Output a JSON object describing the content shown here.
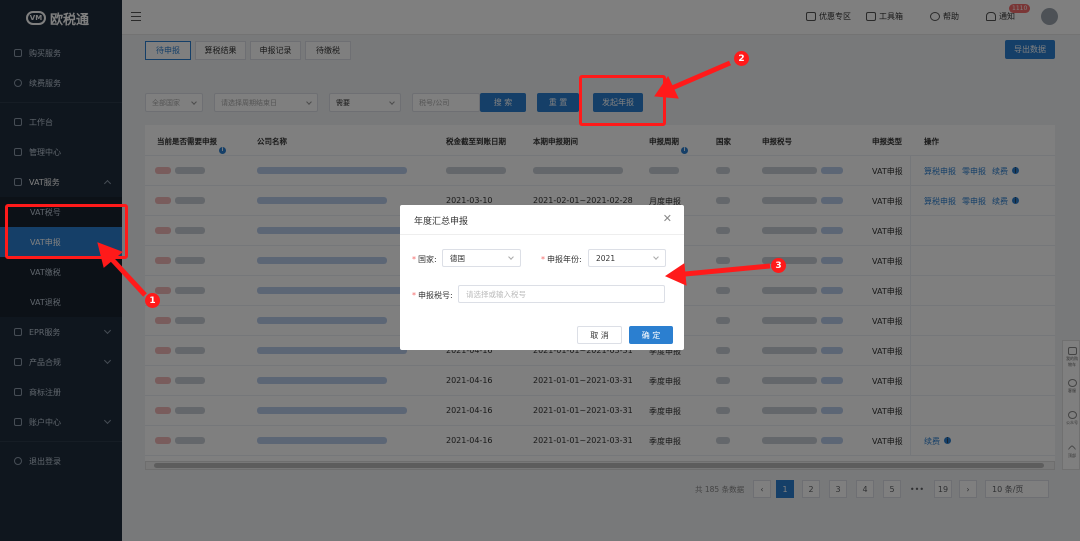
{
  "app": {
    "logo_text": "欧税通",
    "logo_mark": "VM"
  },
  "sidebar": {
    "items": [
      {
        "label": "购买服务",
        "icon": "cart-icon"
      },
      {
        "label": "续费服务",
        "icon": "renew-icon"
      },
      {
        "label": "工作台",
        "icon": "desk-icon"
      },
      {
        "label": "管理中心",
        "icon": "manage-icon"
      },
      {
        "label": "VAT服务",
        "icon": "briefcase-icon"
      },
      {
        "label": "EPR服务",
        "icon": "epr-icon"
      },
      {
        "label": "产品合规",
        "icon": "shield-icon"
      },
      {
        "label": "商标注册",
        "icon": "trademark-icon"
      },
      {
        "label": "账户中心",
        "icon": "account-icon"
      },
      {
        "label": "退出登录",
        "icon": "logout-icon"
      }
    ],
    "vat_sub": [
      "VAT税号",
      "VAT申报",
      "VAT缴税",
      "VAT退税"
    ]
  },
  "topbar": {
    "promo": "优惠专区",
    "toolbox": "工具箱",
    "help": "帮助",
    "notice": "通知",
    "notice_badge": "1110"
  },
  "tabs": [
    "待申报",
    "算税结果",
    "申报记录",
    "待缴税"
  ],
  "export_label": "导出数据",
  "filters": {
    "country_placeholder": "全部国家",
    "date_placeholder": "请选择周期结束日",
    "need_value": "需要",
    "tax_placeholder": "税号/公司",
    "search": "搜 索",
    "reset": "重 置",
    "annual": "发起年报"
  },
  "table": {
    "headers": [
      "当前是否需要申报",
      "公司名称",
      "税金截至到账日期",
      "本期申报期间",
      "申报周期",
      "国家",
      "申报税号",
      "申报类型",
      "操作"
    ],
    "rows": [
      {
        "date": "",
        "period": "",
        "cycle": "",
        "type": "VAT申报",
        "ops": [
          "算税申报",
          "零申报",
          "续费"
        ]
      },
      {
        "date": "2021-03-10",
        "period": "2021-02-01~2021-02-28",
        "cycle": "月度申报",
        "type": "VAT申报",
        "ops": [
          "算税申报",
          "零申报",
          "续费"
        ]
      },
      {
        "date": "",
        "period": "",
        "cycle": "",
        "type": "VAT申报",
        "ops": []
      },
      {
        "date": "",
        "period": "",
        "cycle": "",
        "type": "VAT申报",
        "ops": []
      },
      {
        "date": "",
        "period": "",
        "cycle": "",
        "type": "VAT申报",
        "ops": []
      },
      {
        "date": "",
        "period": "",
        "cycle": "",
        "type": "VAT申报",
        "ops": []
      },
      {
        "date": "2021-04-16",
        "period": "2021-01-01~2021-03-31",
        "cycle": "季度申报",
        "type": "VAT申报",
        "ops": []
      },
      {
        "date": "2021-04-16",
        "period": "2021-01-01~2021-03-31",
        "cycle": "季度申报",
        "type": "VAT申报",
        "ops": []
      },
      {
        "date": "2021-04-16",
        "period": "2021-01-01~2021-03-31",
        "cycle": "季度申报",
        "type": "VAT申报",
        "ops": []
      },
      {
        "date": "2021-04-16",
        "period": "2021-01-01~2021-03-31",
        "cycle": "季度申报",
        "type": "VAT申报",
        "ops": [
          "续费"
        ]
      }
    ]
  },
  "pager": {
    "total": "共 185 条数据",
    "pages": [
      "1",
      "2",
      "3",
      "4",
      "5",
      "•••",
      "19"
    ],
    "size": "10 条/页"
  },
  "dialog": {
    "title": "年度汇总申报",
    "country_label": "国家:",
    "country_value": "德国",
    "year_label": "申报年份:",
    "year_value": "2021",
    "tax_label": "申报税号:",
    "tax_placeholder": "请选择或输入税号",
    "cancel": "取 消",
    "ok": "确 定"
  },
  "callouts": [
    "1",
    "2",
    "3"
  ],
  "right_tools": [
    "我的购物车",
    "客服",
    "公众号",
    "顶部"
  ],
  "accent_color": "#2b7fd0",
  "highlight_color": "#ff1a1a"
}
